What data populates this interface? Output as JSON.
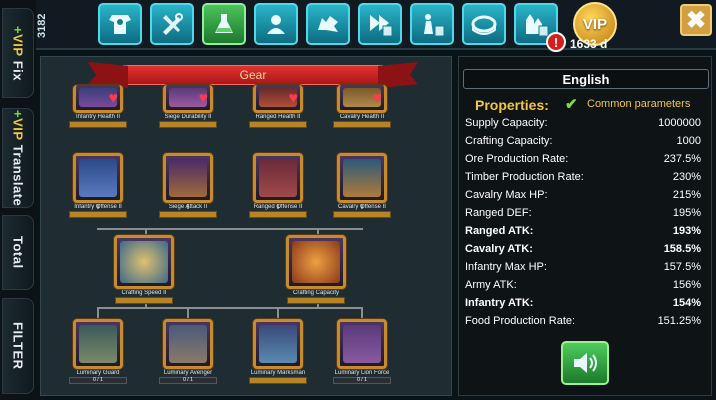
{
  "sidebar": {
    "fix": {
      "plus": "+",
      "vip": "VIP",
      "label": "Fix"
    },
    "translate": {
      "plus": "+",
      "vip": "VIP",
      "label": "Translate"
    },
    "total": "Total",
    "filter": "FILTER"
  },
  "topbar": {
    "count": "3182",
    "nav_icons": [
      "armor-icon",
      "tools-icon",
      "flask-icon",
      "profile-icon",
      "beast-icon",
      "speedup-calc-icon",
      "warrior-calc-icon",
      "arena-icon",
      "castle-calc-icon"
    ],
    "active_index": 2,
    "vip_label": "VIP",
    "vip_alert": "!",
    "vip_days": "1633 d",
    "close": "✖"
  },
  "tree": {
    "banner": "Gear",
    "row1": [
      {
        "name": "Infantry Health II",
        "bar": "",
        "icon": "infantry-health-icon"
      },
      {
        "name": "Siege Durability II",
        "bar": "",
        "icon": "siege-durability-icon"
      },
      {
        "name": "Ranged Health II",
        "bar": "",
        "icon": "ranged-health-icon"
      },
      {
        "name": "Cavalry Health II",
        "bar": "",
        "icon": "cavalry-health-icon"
      }
    ],
    "row2": [
      {
        "name": "Infantry Offense II",
        "bar": "",
        "icon": "infantry-offense-icon"
      },
      {
        "name": "Siege Attack II",
        "bar": "",
        "icon": "siege-attack-icon"
      },
      {
        "name": "Ranged Offense II",
        "bar": "",
        "icon": "ranged-offense-icon"
      },
      {
        "name": "Cavalry Offense II",
        "bar": "",
        "icon": "cavalry-offense-icon"
      }
    ],
    "row3": [
      {
        "name": "Crafting Speed II",
        "bar": "",
        "icon": "crafting-speed-icon"
      },
      {
        "name": "Crafting Capacity",
        "bar": "",
        "icon": "crafting-capacity-icon"
      }
    ],
    "row4": [
      {
        "name": "Luminary Guard",
        "bar": "0 / 1",
        "icon": "luminary-guard-icon"
      },
      {
        "name": "Luminary Avenger",
        "bar": "0 / 1",
        "icon": "luminary-avenger-icon"
      },
      {
        "name": "Luminary Marksman",
        "bar": "",
        "icon": "luminary-marksman-icon"
      },
      {
        "name": "Luminary Lion Force",
        "bar": "0 / 1",
        "icon": "luminary-lion-force-icon"
      }
    ]
  },
  "props": {
    "language": "English",
    "title": "Properties:",
    "common_label": "Common parameters",
    "common_checked": true,
    "rows": [
      {
        "label": "Supply Capacity:",
        "value": "1000000",
        "bold": false
      },
      {
        "label": "Crafting Capacity:",
        "value": "1000",
        "bold": false
      },
      {
        "label": "Ore Production Rate:",
        "value": "237.5%",
        "bold": false
      },
      {
        "label": "Timber Production Rate:",
        "value": "230%",
        "bold": false
      },
      {
        "label": "Cavalry Max HP:",
        "value": "215%",
        "bold": false
      },
      {
        "label": "Ranged DEF:",
        "value": "195%",
        "bold": false
      },
      {
        "label": "Ranged ATK:",
        "value": "193%",
        "bold": true
      },
      {
        "label": "Cavalry ATK:",
        "value": "158.5%",
        "bold": true
      },
      {
        "label": "Infantry Max HP:",
        "value": "157.5%",
        "bold": false
      },
      {
        "label": "Army ATK:",
        "value": "156%",
        "bold": false
      },
      {
        "label": "Infantry ATK:",
        "value": "154%",
        "bold": true
      },
      {
        "label": "Food Production Rate:",
        "value": "151.25%",
        "bold": false
      }
    ]
  },
  "colors": {
    "accent_gold": "#f3c63d",
    "nav_teal": "#2ab4c8",
    "active_green": "#4cc35a",
    "banner_red": "#c7201f",
    "node_border": "#c58b2e"
  }
}
